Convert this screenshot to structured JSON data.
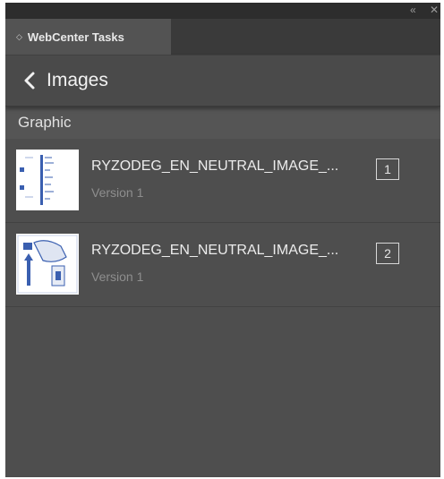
{
  "titlebar": {
    "collapse_glyph": "«",
    "close_glyph": "✕"
  },
  "tab": {
    "grip_glyph": "◇",
    "label": "WebCenter Tasks"
  },
  "nav": {
    "title": "Images"
  },
  "section": {
    "label": "Graphic"
  },
  "items": [
    {
      "name": "RYZODEG_EN_NEUTRAL_IMAGE_...",
      "version": "Version 1",
      "count": "1",
      "thumbnail_icon": "document-thumbnail-icon"
    },
    {
      "name": "RYZODEG_EN_NEUTRAL_IMAGE_...",
      "version": "Version 1",
      "count": "2",
      "thumbnail_icon": "injection-pen-thumbnail-icon"
    }
  ],
  "colors": {
    "panel_bg": "#4e4e4e",
    "nav_bg": "#4a4a4a",
    "section_bg": "#555555",
    "accent_blue": "#3a5fb0"
  }
}
